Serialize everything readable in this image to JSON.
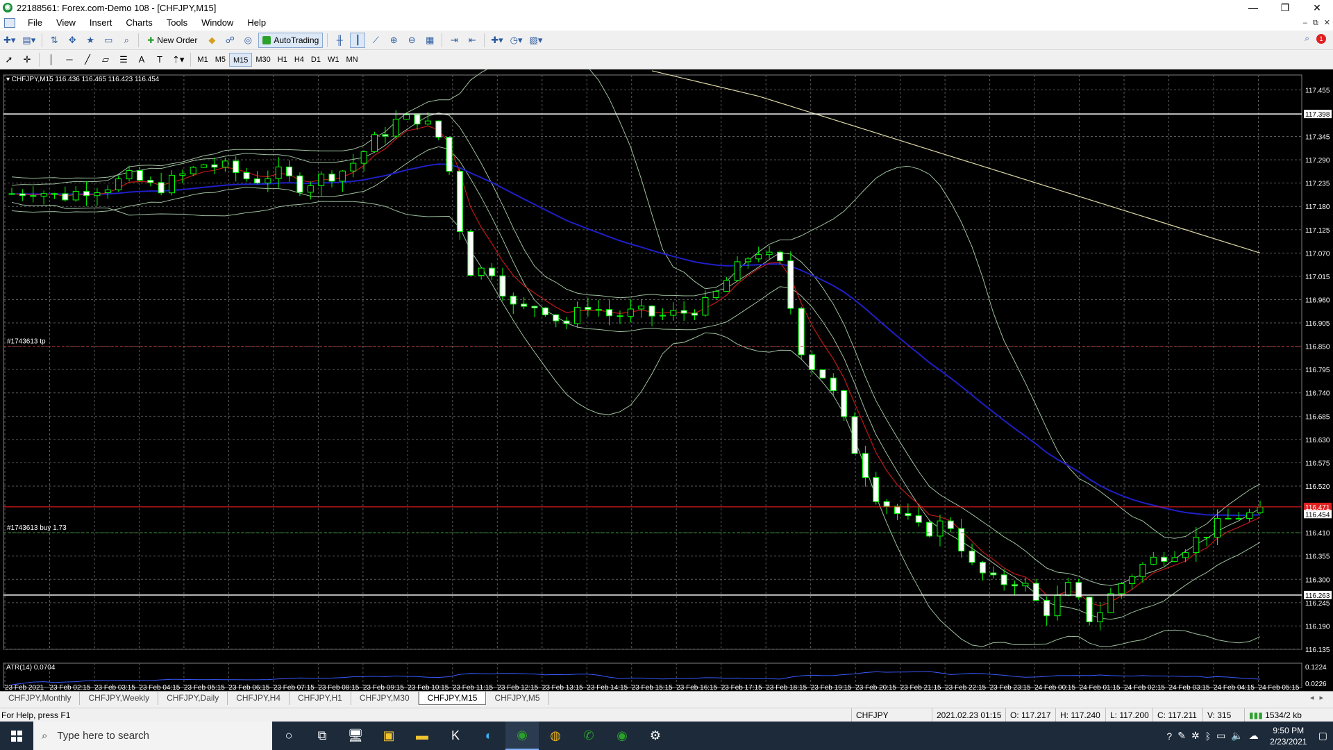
{
  "window": {
    "title": "22188561: Forex.com-Demo 108 - [CHFJPY,M15]",
    "controls": [
      "—",
      "❐",
      "✕"
    ]
  },
  "menu": [
    "File",
    "View",
    "Insert",
    "Charts",
    "Tools",
    "Window",
    "Help"
  ],
  "toolbar": {
    "new_order_label": "New Order",
    "autotrading_label": "AutoTrading"
  },
  "timeframes": [
    "M1",
    "M5",
    "M15",
    "M30",
    "H1",
    "H4",
    "D1",
    "W1",
    "MN"
  ],
  "active_timeframe": "M15",
  "chart": {
    "header": "CHFJPY,M15  116.436 116.465 116.423 116.454",
    "tp_label": "#1743613 tp",
    "buy_label": "#1743613 buy 1.73",
    "atr_label": "ATR(14) 0.0704",
    "current_price": "116.454",
    "bid_marker": "116.471",
    "colors": {
      "background": "#000000",
      "grid": "#5a5a5a",
      "bull": "#ffffff",
      "bear": "#00ff00",
      "ema_fast": "#c01818",
      "ema_slow": "#1f1fc8",
      "bands": "#9fbf9f",
      "long_ma": "#ddd8a8",
      "atr": "#3a5aff",
      "tp_line": "#c03030",
      "buy_line": "#30a030",
      "hline": "#ffffff",
      "price_line": "#ff2020"
    }
  },
  "chart_data": {
    "type": "candlestick",
    "symbol": "CHFJPY",
    "timeframe": "M15",
    "price_axis_ticks": [
      "117.455",
      "117.345",
      "117.290",
      "117.235",
      "117.180",
      "117.125",
      "117.070",
      "117.015",
      "116.960",
      "116.905",
      "116.850",
      "116.795",
      "116.740",
      "116.685",
      "116.630",
      "116.575",
      "116.520",
      "116.410",
      "116.355",
      "116.300",
      "116.245",
      "116.190",
      "116.135"
    ],
    "price_axis_markers": [
      {
        "label": "117.398",
        "value": 117.398
      },
      {
        "label": "116.471",
        "value": 116.471
      },
      {
        "label": "116.454",
        "value": 116.454
      },
      {
        "label": "116.263",
        "value": 116.263
      }
    ],
    "atr_axis_ticks": [
      "0.1224",
      "0.0226"
    ],
    "ylim": [
      116.135,
      117.49
    ],
    "time_labels": [
      "23 Feb 2021",
      "23 Feb 02:15",
      "23 Feb 03:15",
      "23 Feb 04:15",
      "23 Feb 05:15",
      "23 Feb 06:15",
      "23 Feb 07:15",
      "23 Feb 08:15",
      "23 Feb 09:15",
      "23 Feb 10:15",
      "23 Feb 11:15",
      "23 Feb 12:15",
      "23 Feb 13:15",
      "23 Feb 14:15",
      "23 Feb 15:15",
      "23 Feb 16:15",
      "23 Feb 17:15",
      "23 Feb 18:15",
      "23 Feb 19:15",
      "23 Feb 20:15",
      "23 Feb 21:15",
      "23 Feb 22:15",
      "23 Feb 23:15",
      "24 Feb 00:15",
      "24 Feb 01:15",
      "24 Feb 02:15",
      "24 Feb 03:15",
      "24 Feb 04:15",
      "24 Feb 05:15"
    ],
    "hlines": [
      117.398,
      116.263
    ],
    "tp_level": 116.85,
    "buy_level": 116.41,
    "price_line": 116.471,
    "close_anchors": [
      117.21,
      117.22,
      117.2,
      117.22,
      117.23,
      117.25,
      117.22,
      117.25,
      117.28,
      117.27,
      117.24,
      117.26,
      117.23,
      117.25,
      117.27,
      117.33,
      117.38,
      117.39,
      117.33,
      117.03,
      117.03,
      116.93,
      116.95,
      116.9,
      116.95,
      116.92,
      116.93,
      116.92,
      116.93,
      116.95,
      117.02,
      117.08,
      117.04,
      116.82,
      116.77,
      116.62,
      116.5,
      116.45,
      116.41,
      116.44,
      116.33,
      116.29,
      116.3,
      116.22,
      116.28,
      116.2,
      116.28,
      116.33,
      116.36,
      116.38,
      116.42,
      116.45,
      116.455
    ],
    "atr_range": [
      0.0226,
      0.1224
    ]
  },
  "tabs": [
    "CHFJPY,Monthly",
    "CHFJPY,Weekly",
    "CHFJPY,Daily",
    "CHFJPY,H4",
    "CHFJPY,H1",
    "CHFJPY,M30",
    "CHFJPY,M15",
    "CHFJPY,M5"
  ],
  "active_tab": "CHFJPY,M15",
  "status": {
    "help": "For Help, press F1",
    "symbol": "CHFJPY",
    "datetime": "2021.02.23 01:15",
    "open": "O: 117.217",
    "high": "H: 117.240",
    "low": "L: 117.200",
    "close": "C: 117.211",
    "volume": "V: 315",
    "traffic": "1534/2 kb"
  },
  "taskbar": {
    "search_placeholder": "Type here to search",
    "time": "9:50 PM",
    "date": "2/23/2021"
  }
}
